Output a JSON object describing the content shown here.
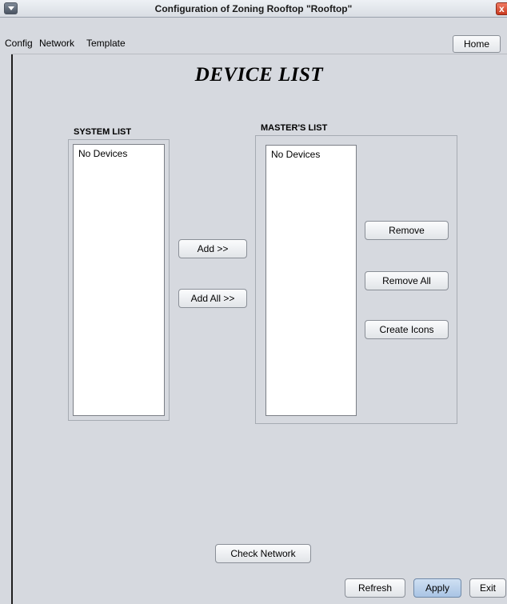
{
  "window": {
    "title": "Configuration of Zoning Rooftop \"Rooftop\"",
    "close_glyph": "x"
  },
  "menubar": {
    "items": [
      "Config",
      "Network",
      "Template"
    ],
    "home_label": "Home"
  },
  "page_title": "DEVICE LIST",
  "system_list": {
    "label": "SYSTEM LIST",
    "items": [
      "No Devices"
    ]
  },
  "masters_list": {
    "label": "MASTER'S LIST",
    "items": [
      "No Devices"
    ]
  },
  "buttons": {
    "add": "Add >>",
    "add_all": "Add All >>",
    "remove": "Remove",
    "remove_all": "Remove All",
    "create_icons": "Create Icons",
    "check_network": "Check Network",
    "refresh": "Refresh",
    "apply": "Apply",
    "exit": "Exit"
  },
  "icons": {
    "system_menu": "chevron-down-icon",
    "close": "close-icon"
  }
}
